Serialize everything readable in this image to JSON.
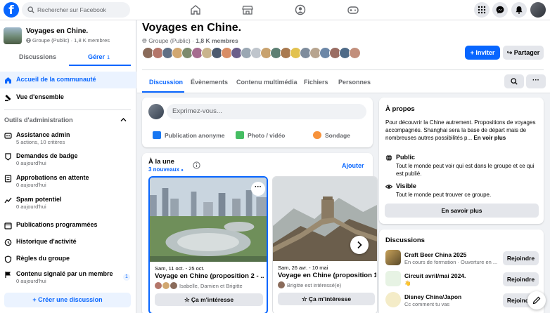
{
  "topbar": {
    "logo": "f",
    "search_placeholder": "Rechercher sur Facebook",
    "nav_icons": [
      "home-icon",
      "marketplace-icon",
      "groups-icon",
      "gaming-icon"
    ],
    "right_icons": [
      "menu-grid-icon",
      "messenger-icon",
      "bell-icon"
    ]
  },
  "sidebar": {
    "group_name": "Voyages en Chine.",
    "group_meta": "Groupe (Public) · 1,8 K membres",
    "tabs": [
      {
        "label": "Discussions"
      },
      {
        "label": "Gérer",
        "count": "1"
      }
    ],
    "top_items": [
      {
        "label": "Accueil de la communauté",
        "icon": "home-icon"
      },
      {
        "label": "Vue d'ensemble",
        "icon": "overview-icon"
      }
    ],
    "section_title": "Outils d'administration",
    "admin_items": [
      {
        "label": "Assistance admin",
        "sub": "5 actions, 10 critères",
        "icon": "assistant-icon"
      },
      {
        "label": "Demandes de badge",
        "sub": "0 aujourd'hui",
        "icon": "badge-icon"
      },
      {
        "label": "Approbations en attente",
        "sub": "0 aujourd'hui",
        "icon": "approval-icon"
      },
      {
        "label": "Spam potentiel",
        "sub": "0 aujourd'hui",
        "icon": "spam-icon"
      },
      {
        "label": "Publications programmées",
        "sub": "",
        "icon": "calendar-icon"
      },
      {
        "label": "Historique d'activité",
        "sub": "",
        "icon": "history-icon"
      },
      {
        "label": "Règles du groupe",
        "sub": "",
        "icon": "rules-icon"
      },
      {
        "label": "Contenu signalé par un membre",
        "sub": "0 aujourd'hui",
        "icon": "report-icon",
        "badge": "1"
      }
    ],
    "create_button": "+ Créer une discussion"
  },
  "group": {
    "title": "Voyages en Chine.",
    "privacy": "Groupe (Public)",
    "members": "1,8 K membres",
    "invite_label": "+ Inviter",
    "share_label": "Partager",
    "tabs": [
      "Discussion",
      "Évènements",
      "Contenu multimédia",
      "Fichiers",
      "Personnes"
    ],
    "more_label": "···"
  },
  "composer": {
    "placeholder": "Exprimez-vous...",
    "actions": [
      {
        "label": "Publication anonyme",
        "color": "#1877f2"
      },
      {
        "label": "Photo / vidéo",
        "color": "#45bd62"
      },
      {
        "label": "Sondage",
        "color": "#f7923b"
      }
    ]
  },
  "featured": {
    "title": "À la une",
    "new_count": "3 nouveaux",
    "add_label": "Ajouter",
    "posts": [
      {
        "date": "Sam, 11 oct. - 25 oct.",
        "title": "Voyage en Chine (proposition 2 - ...",
        "interested": "Isabelle, Damien et Brigitte",
        "button": "Ça m'intéresse"
      },
      {
        "date": "Sam, 26 avr. - 10 mai",
        "title": "Voyage en Chine (proposition 1",
        "interested": "Brigitte est intéressé(e)",
        "button": "Ça m'intéresse"
      }
    ]
  },
  "about": {
    "title": "À propos",
    "description": "Pour découvrir la Chine autrement. Propositions de voyages accompagnés. Shanghai sera la base de départ mais de nombreuses autres possibilités p...",
    "see_more": "En voir plus",
    "public_title": "Public",
    "public_text": "Tout le monde peut voir qui est dans le groupe et ce qui est publié.",
    "visible_title": "Visible",
    "visible_text": "Tout le monde peut trouver ce groupe.",
    "button": "En savoir plus"
  },
  "discussions": {
    "title": "Discussions",
    "items": [
      {
        "name": "Craft Beer China 2025",
        "status": "En cours de formation · Ouverture en ...",
        "button": "Rejoindre"
      },
      {
        "name": "Circuit avril/mai 2024.",
        "status": "👋",
        "button": "Rejoindre"
      },
      {
        "name": "Disney Chine/Japon",
        "status": "Cc comment tu vas",
        "button": "Rejoindre"
      }
    ]
  }
}
